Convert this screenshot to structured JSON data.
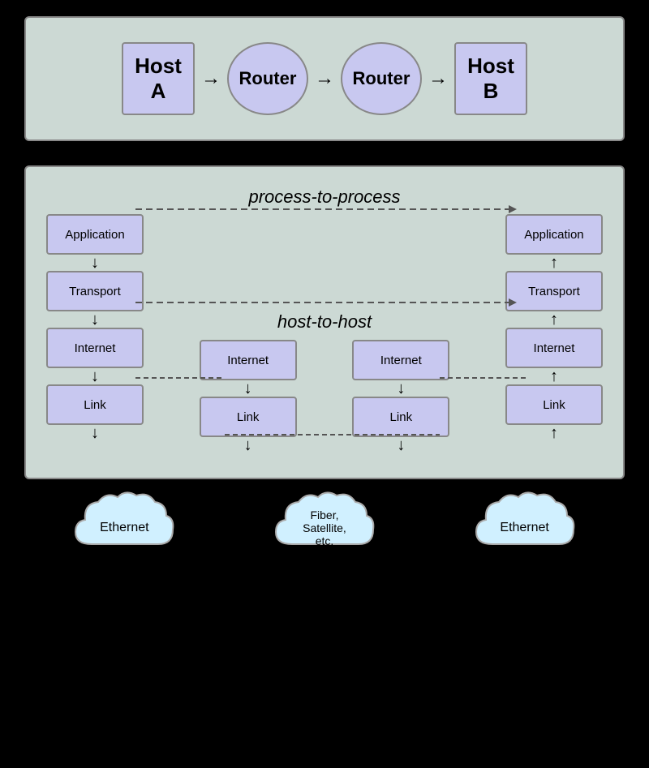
{
  "top": {
    "hostA": "Host\nA",
    "hostB": "Host\nB",
    "router1": "Router",
    "router2": "Router"
  },
  "bottom": {
    "processToProcess": "process-to-process",
    "hostToHost": "host-to-host",
    "leftHost": {
      "layers": [
        "Application",
        "Transport",
        "Internet",
        "Link"
      ]
    },
    "leftRouter": {
      "layers": [
        "Internet",
        "Link"
      ]
    },
    "rightRouter": {
      "layers": [
        "Internet",
        "Link"
      ]
    },
    "rightHost": {
      "layers": [
        "Application",
        "Transport",
        "Internet",
        "Link"
      ]
    }
  },
  "clouds": {
    "left": "Ethernet",
    "middle": "Fiber,\nSatellite,\netc.",
    "right": "Ethernet"
  }
}
